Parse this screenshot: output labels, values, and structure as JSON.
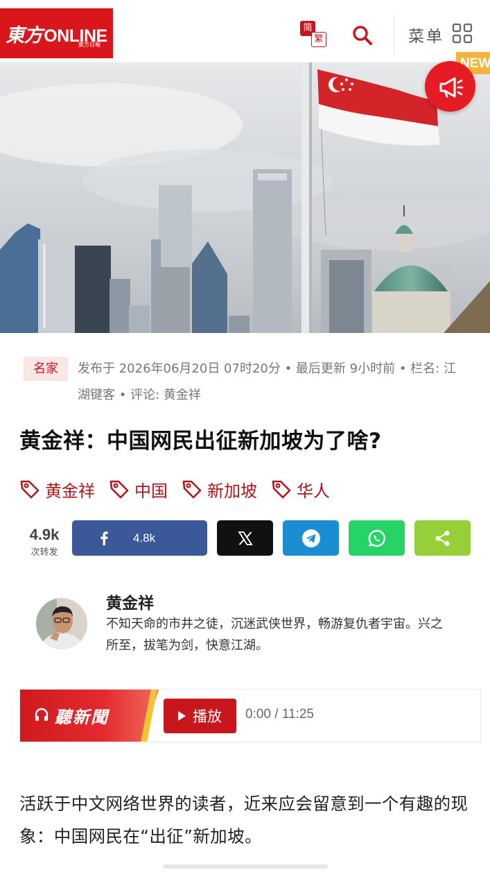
{
  "header": {
    "logo_text": "ONLINE",
    "logo_cn": "東方",
    "logo_sub": "東方日報",
    "trad_icon_simplified": "简",
    "trad_icon_traditional": "繁",
    "menu_label": "菜单"
  },
  "hero": {
    "new_badge": "NEW"
  },
  "article": {
    "category": "名家",
    "meta": "发布于 2026年06月20日 07时20分 • 最后更新 9小时前 • 栏名: 江湖键客 • 评论: 黄金祥",
    "title": "黄金祥：中国网民出征新加坡为了啥?",
    "tags": [
      "黄金祥",
      "中国",
      "新加坡",
      "华人"
    ],
    "body": "活跃于中文网络世界的读者，近来应会留意到一个有趣的现象：中国网民在“出征”新加坡。"
  },
  "share": {
    "total": "4.9k",
    "total_label": "次转发",
    "facebook_count": "4.8k",
    "buttons": [
      "facebook-icon",
      "x-icon",
      "telegram-icon",
      "whatsapp-icon",
      "share-icon"
    ]
  },
  "author": {
    "name": "黄金祥",
    "bio": "不知天命的市井之徒，沉迷武侠世界，畅游复仇者宇宙。兴之所至，拔笔为剑，快意江湖。"
  },
  "player": {
    "brand": "聽新聞",
    "play_label": "播放",
    "time": "0:00 / 11:25"
  },
  "colors": {
    "brand_red": "#d9161c",
    "facebook": "#3b5998",
    "x": "#111111",
    "telegram": "#1b8ed3",
    "whatsapp": "#25d366",
    "share": "#95d03a",
    "new_badge": "#f4b43c"
  }
}
